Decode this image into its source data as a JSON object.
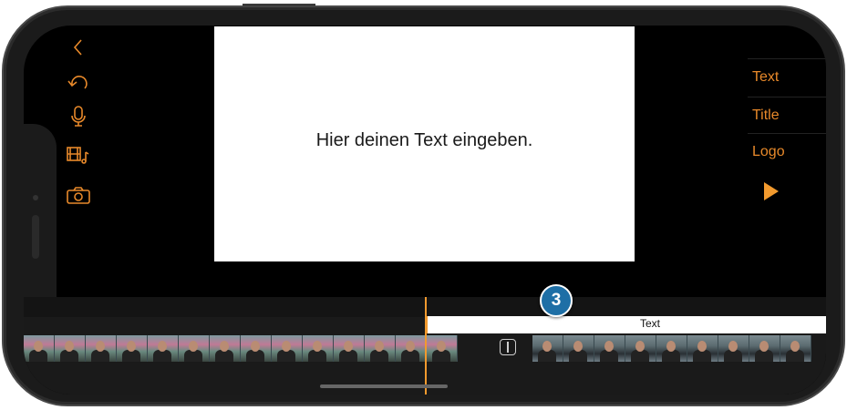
{
  "toolbar_left": {
    "icons": [
      "back-chevron-icon",
      "undo-icon",
      "microphone-icon",
      "film-music-icon",
      "camera-icon"
    ],
    "accent_color": "#e8892a"
  },
  "preview": {
    "text": "Hier deinen Text eingeben."
  },
  "menu_right": {
    "items": [
      {
        "label": "Text"
      },
      {
        "label": "Title"
      },
      {
        "label": "Logo"
      }
    ],
    "play_icon": "play-icon"
  },
  "timeline": {
    "text_track_label": "Text",
    "transition_icon": "transition-icon"
  },
  "callout": {
    "number": "3",
    "color": "#1e6fa6"
  }
}
